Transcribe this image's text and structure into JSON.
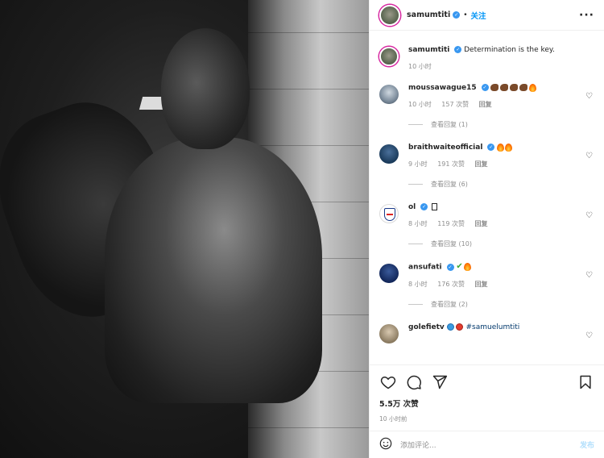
{
  "post": {
    "author": "samumtiti",
    "follow_label": "关注",
    "dot": "•",
    "more": "···"
  },
  "caption": {
    "username": "samumtiti",
    "text": "Determination is the key.",
    "time": "10 小时"
  },
  "comments": [
    {
      "username": "moussawague15",
      "emojis": [
        "flexed-biceps-dark",
        "flexed-biceps-dark",
        "flexed-biceps-dark",
        "flexed-biceps-dark",
        "fire"
      ],
      "time": "10 小时",
      "likes": "157 次赞",
      "reply": "回复",
      "view_replies": "查看回复 (1)"
    },
    {
      "username": "braithwaiteofficial",
      "emojis": [
        "fire",
        "fire"
      ],
      "time": "9 小时",
      "likes": "191 次赞",
      "reply": "回复",
      "view_replies": "查看回复 (6)"
    },
    {
      "username": "ol",
      "emojis": [
        "unknown-glyph"
      ],
      "time": "8 小时",
      "likes": "119 次赞",
      "reply": "回复",
      "view_replies": "查看回复 (10)"
    },
    {
      "username": "ansufati",
      "emojis": [
        "check-mark",
        "fire"
      ],
      "time": "8 小时",
      "likes": "176 次赞",
      "reply": "回复",
      "view_replies": "查看回复 (2)"
    },
    {
      "username": "golefietv",
      "emojis": [
        "blue-circle",
        "red-circle"
      ],
      "text": "#samuelumtiti"
    }
  ],
  "footer": {
    "likes_count": "5.5万 次赞",
    "posted_time": "10 小时前",
    "comment_placeholder": "添加评论...",
    "post_label": "发布"
  },
  "colors": {
    "accent": "#0095f6",
    "verified": "#3897f0",
    "muted": "#8e8e8e"
  }
}
